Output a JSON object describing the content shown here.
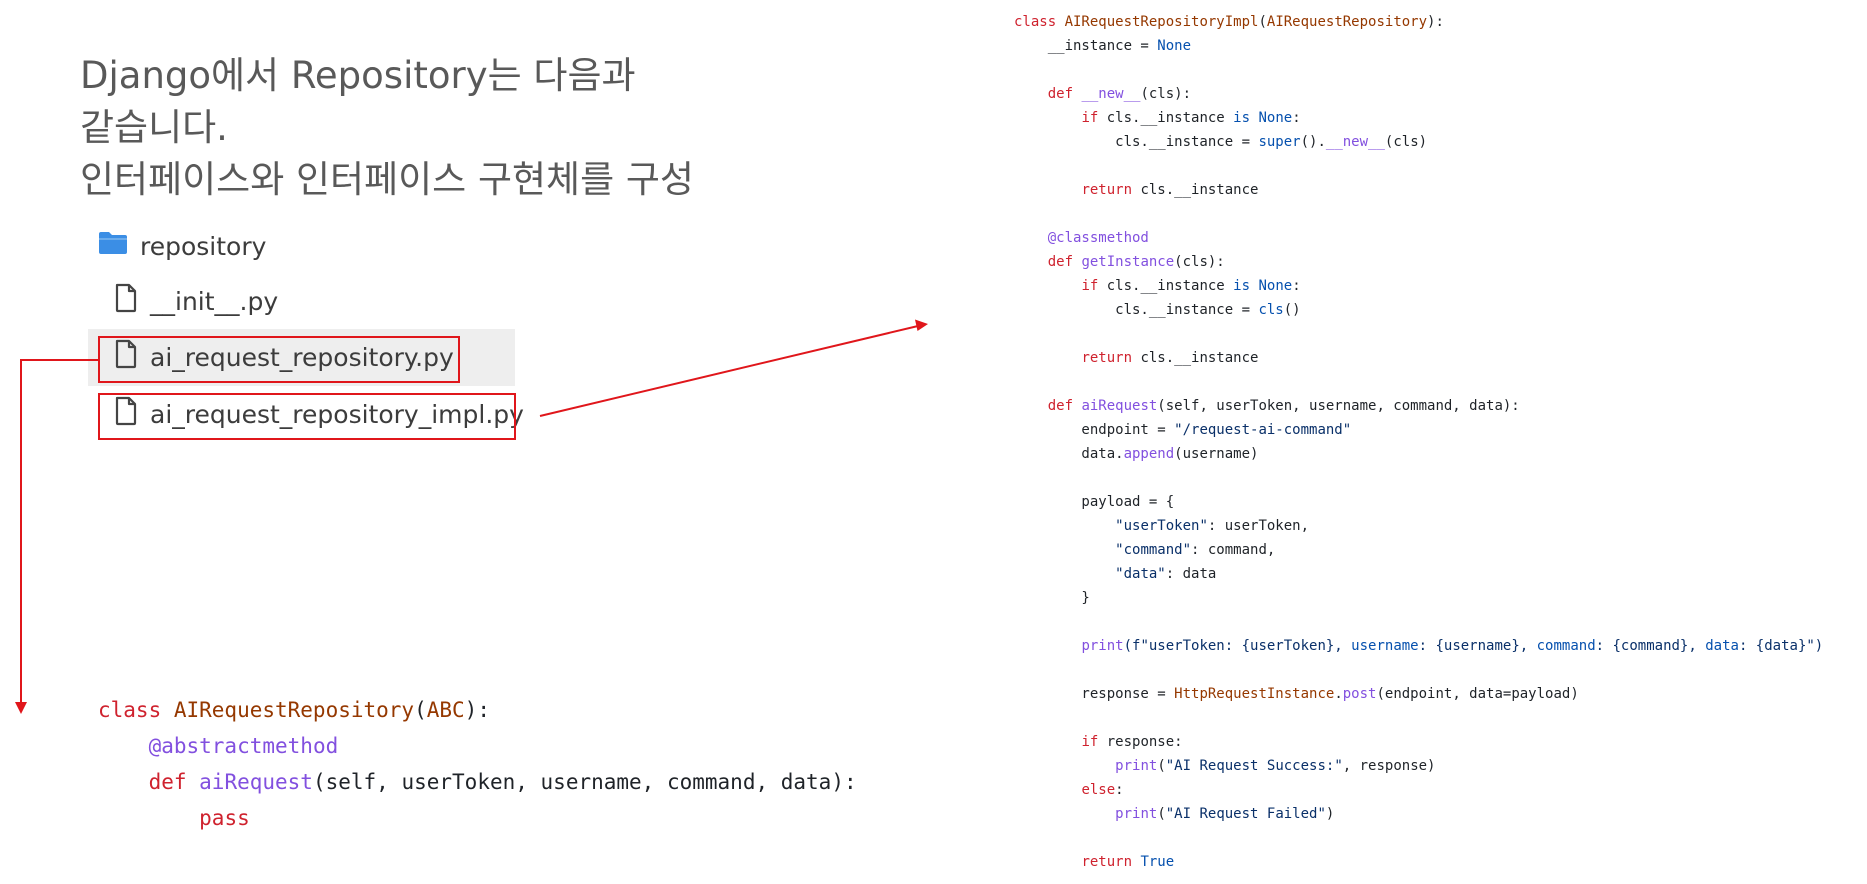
{
  "slide": {
    "title_lines": [
      "Django에서 Repository는 다음과",
      "같습니다.",
      "인터페이스와 인터페이스 구현체를 구성"
    ]
  },
  "file_tree": {
    "folder": {
      "label": "repository",
      "icon": "folder-icon"
    },
    "files": [
      {
        "label": "__init__.py",
        "icon": "file-icon",
        "highlighted": false,
        "boxed": false
      },
      {
        "label": "ai_request_repository.py",
        "icon": "file-icon",
        "highlighted": true,
        "boxed": true
      },
      {
        "label": "ai_request_repository_impl.py",
        "icon": "file-icon",
        "highlighted": false,
        "boxed": true
      }
    ]
  },
  "code_interface": [
    [
      {
        "t": "class ",
        "c": "kw"
      },
      {
        "t": "AIRequestRepository",
        "c": "cls"
      },
      {
        "t": "(",
        "c": "plain"
      },
      {
        "t": "ABC",
        "c": "cls"
      },
      {
        "t": "):",
        "c": "plain"
      }
    ],
    [
      {
        "t": "    ",
        "c": "plain"
      },
      {
        "t": "@abstractmethod",
        "c": "dec"
      }
    ],
    [
      {
        "t": "    ",
        "c": "plain"
      },
      {
        "t": "def ",
        "c": "kw"
      },
      {
        "t": "aiRequest",
        "c": "fn"
      },
      {
        "t": "(self, userToken, username, command, data):",
        "c": "plain"
      }
    ],
    [
      {
        "t": "        ",
        "c": "plain"
      },
      {
        "t": "pass",
        "c": "kw"
      }
    ]
  ],
  "code_impl": [
    [
      {
        "t": "class ",
        "c": "kw"
      },
      {
        "t": "AIRequestRepositoryImpl",
        "c": "cls"
      },
      {
        "t": "(",
        "c": "plain"
      },
      {
        "t": "AIRequestRepository",
        "c": "cls"
      },
      {
        "t": "):",
        "c": "plain"
      }
    ],
    [
      {
        "t": "    __instance = ",
        "c": "plain"
      },
      {
        "t": "None",
        "c": "const"
      }
    ],
    [],
    [
      {
        "t": "    ",
        "c": "plain"
      },
      {
        "t": "def ",
        "c": "kw"
      },
      {
        "t": "__new__",
        "c": "fn"
      },
      {
        "t": "(cls):",
        "c": "plain"
      }
    ],
    [
      {
        "t": "        ",
        "c": "plain"
      },
      {
        "t": "if ",
        "c": "kw"
      },
      {
        "t": "cls.__instance ",
        "c": "plain"
      },
      {
        "t": "is None",
        "c": "const"
      },
      {
        "t": ":",
        "c": "plain"
      }
    ],
    [
      {
        "t": "            cls.__instance = ",
        "c": "plain"
      },
      {
        "t": "super",
        "c": "const"
      },
      {
        "t": "().",
        "c": "plain"
      },
      {
        "t": "__new__",
        "c": "fn"
      },
      {
        "t": "(cls)",
        "c": "plain"
      }
    ],
    [],
    [
      {
        "t": "        ",
        "c": "plain"
      },
      {
        "t": "return ",
        "c": "kw"
      },
      {
        "t": "cls.__instance",
        "c": "plain"
      }
    ],
    [],
    [
      {
        "t": "    ",
        "c": "plain"
      },
      {
        "t": "@classmethod",
        "c": "dec"
      }
    ],
    [
      {
        "t": "    ",
        "c": "plain"
      },
      {
        "t": "def ",
        "c": "kw"
      },
      {
        "t": "getInstance",
        "c": "fn"
      },
      {
        "t": "(cls):",
        "c": "plain"
      }
    ],
    [
      {
        "t": "        ",
        "c": "plain"
      },
      {
        "t": "if ",
        "c": "kw"
      },
      {
        "t": "cls.__instance ",
        "c": "plain"
      },
      {
        "t": "is None",
        "c": "const"
      },
      {
        "t": ":",
        "c": "plain"
      }
    ],
    [
      {
        "t": "            cls.__instance = ",
        "c": "plain"
      },
      {
        "t": "cls",
        "c": "const"
      },
      {
        "t": "()",
        "c": "plain"
      }
    ],
    [],
    [
      {
        "t": "        ",
        "c": "plain"
      },
      {
        "t": "return ",
        "c": "kw"
      },
      {
        "t": "cls.__instance",
        "c": "plain"
      }
    ],
    [],
    [
      {
        "t": "    ",
        "c": "plain"
      },
      {
        "t": "def ",
        "c": "kw"
      },
      {
        "t": "aiRequest",
        "c": "fn"
      },
      {
        "t": "(self, userToken, username, command, data):",
        "c": "plain"
      }
    ],
    [
      {
        "t": "        endpoint = ",
        "c": "plain"
      },
      {
        "t": "\"/request-ai-command\"",
        "c": "str"
      }
    ],
    [
      {
        "t": "        data.",
        "c": "plain"
      },
      {
        "t": "append",
        "c": "fn"
      },
      {
        "t": "(username)",
        "c": "plain"
      }
    ],
    [],
    [
      {
        "t": "        payload = {",
        "c": "plain"
      }
    ],
    [
      {
        "t": "            ",
        "c": "plain"
      },
      {
        "t": "\"userToken\"",
        "c": "str"
      },
      {
        "t": ": userToken,",
        "c": "plain"
      }
    ],
    [
      {
        "t": "            ",
        "c": "plain"
      },
      {
        "t": "\"command\"",
        "c": "str"
      },
      {
        "t": ": command,",
        "c": "plain"
      }
    ],
    [
      {
        "t": "            ",
        "c": "plain"
      },
      {
        "t": "\"data\"",
        "c": "str"
      },
      {
        "t": ": data",
        "c": "plain"
      }
    ],
    [
      {
        "t": "        }",
        "c": "plain"
      }
    ],
    [],
    [
      {
        "t": "        ",
        "c": "plain"
      },
      {
        "t": "print",
        "c": "fn"
      },
      {
        "t": "(f\"userToken: {userToken}, ",
        "c": "str"
      },
      {
        "t": "username",
        "c": "const"
      },
      {
        "t": ": {username}, ",
        "c": "str"
      },
      {
        "t": "command",
        "c": "const"
      },
      {
        "t": ": {command}, ",
        "c": "str"
      },
      {
        "t": "data",
        "c": "const"
      },
      {
        "t": ": {data}\")",
        "c": "str"
      }
    ],
    [],
    [
      {
        "t": "        response = ",
        "c": "plain"
      },
      {
        "t": "HttpRequestInstance",
        "c": "cls"
      },
      {
        "t": ".",
        "c": "plain"
      },
      {
        "t": "post",
        "c": "fn"
      },
      {
        "t": "(endpoint, data=payload)",
        "c": "plain"
      }
    ],
    [],
    [
      {
        "t": "        ",
        "c": "plain"
      },
      {
        "t": "if ",
        "c": "kw"
      },
      {
        "t": "response:",
        "c": "plain"
      }
    ],
    [
      {
        "t": "            ",
        "c": "plain"
      },
      {
        "t": "print",
        "c": "fn"
      },
      {
        "t": "(",
        "c": "plain"
      },
      {
        "t": "\"AI Request Success:\"",
        "c": "str"
      },
      {
        "t": ", response)",
        "c": "plain"
      }
    ],
    [
      {
        "t": "        ",
        "c": "plain"
      },
      {
        "t": "else",
        "c": "kw"
      },
      {
        "t": ":",
        "c": "plain"
      }
    ],
    [
      {
        "t": "            ",
        "c": "plain"
      },
      {
        "t": "print",
        "c": "fn"
      },
      {
        "t": "(",
        "c": "plain"
      },
      {
        "t": "\"AI Request Failed\"",
        "c": "str"
      },
      {
        "t": ")",
        "c": "plain"
      }
    ],
    [],
    [
      {
        "t": "        ",
        "c": "plain"
      },
      {
        "t": "return ",
        "c": "kw"
      },
      {
        "t": "True",
        "c": "const"
      }
    ]
  ],
  "colors": {
    "annotation_red": "#e0161b",
    "title_gray": "#595959",
    "folder_blue": "#3b8ee5",
    "highlight_gray": "#eeeeee"
  }
}
